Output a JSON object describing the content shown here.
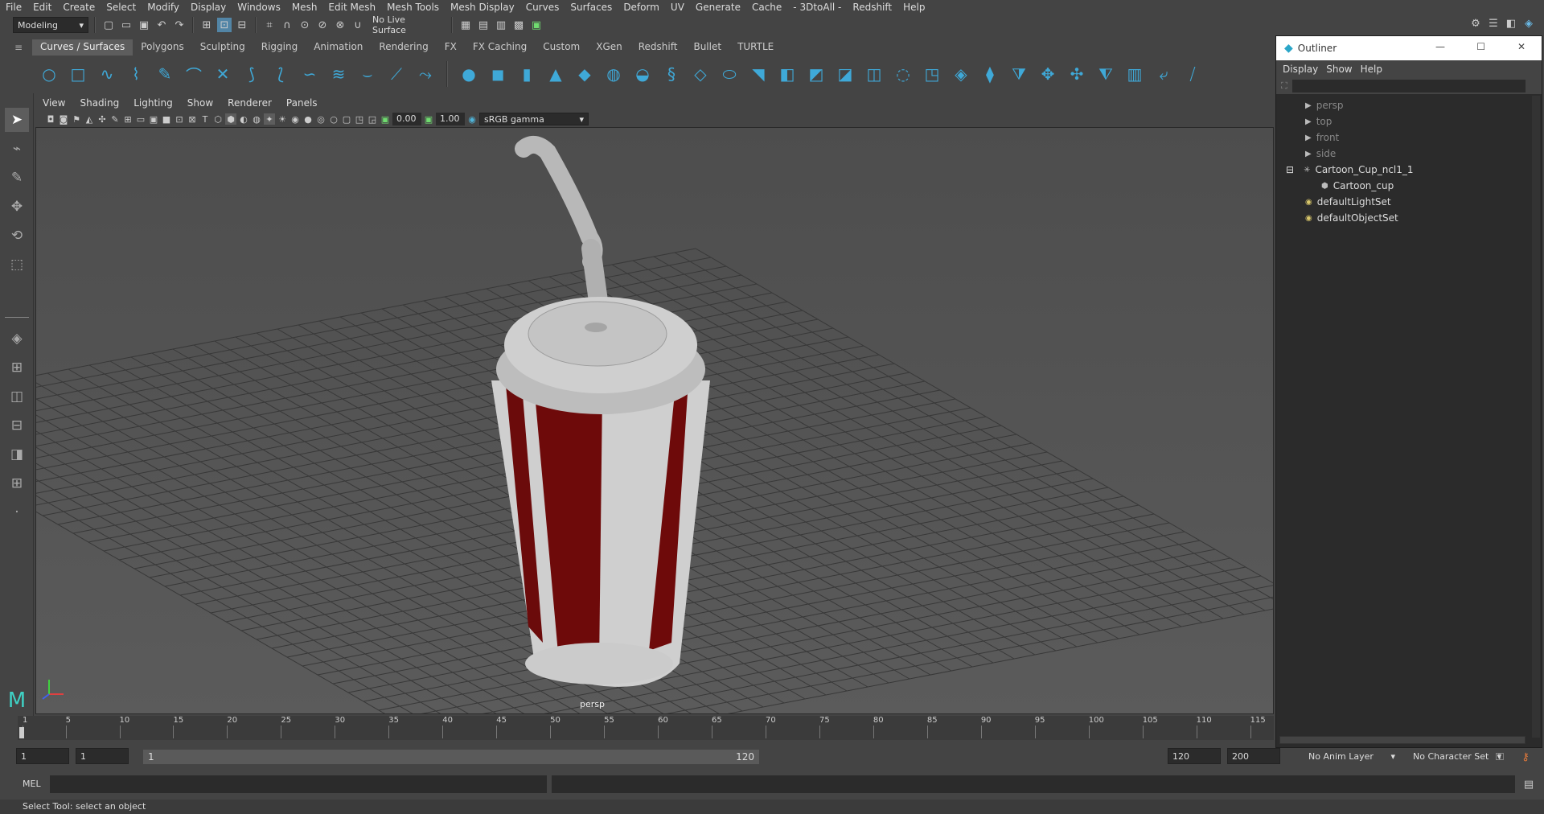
{
  "menubar": [
    "File",
    "Edit",
    "Create",
    "Select",
    "Modify",
    "Display",
    "Windows",
    "Mesh",
    "Edit Mesh",
    "Mesh Tools",
    "Mesh Display",
    "Curves",
    "Surfaces",
    "Deform",
    "UV",
    "Generate",
    "Cache",
    "- 3DtoAll -",
    "Redshift",
    "Help"
  ],
  "status": {
    "mode": "Modeling",
    "live_surface": "No Live Surface"
  },
  "shelf_tabs": [
    "Curves / Surfaces",
    "Polygons",
    "Sculpting",
    "Rigging",
    "Animation",
    "Rendering",
    "FX",
    "FX Caching",
    "Custom",
    "XGen",
    "Redshift",
    "Bullet",
    "TURTLE"
  ],
  "viewport": {
    "menu": [
      "View",
      "Shading",
      "Lighting",
      "Show",
      "Renderer",
      "Panels"
    ],
    "exposure": "0.00",
    "gamma": "1.00",
    "color_space": "sRGB gamma",
    "camera_label": "persp"
  },
  "timeline": {
    "ticks": [
      "1",
      "5",
      "10",
      "15",
      "20",
      "25",
      "30",
      "35",
      "40",
      "45",
      "50",
      "55",
      "60",
      "65",
      "70",
      "75",
      "80",
      "85",
      "90",
      "95",
      "100",
      "105",
      "110",
      "115"
    ],
    "current_frame": "1"
  },
  "range": {
    "start": "1",
    "playback_start": "1",
    "slider_start": "1",
    "slider_end": "120",
    "playback_end": "120",
    "end": "200",
    "anim_layer": "No Anim Layer",
    "character_set": "No Character Set"
  },
  "cmdline": {
    "label": "MEL"
  },
  "help_line": "Select Tool: select an object",
  "outliner": {
    "title": "Outliner",
    "menu": [
      "Display",
      "Show",
      "Help"
    ],
    "items": [
      {
        "label": "persp",
        "type": "camera",
        "dim": true,
        "indent": 1
      },
      {
        "label": "top",
        "type": "camera",
        "dim": true,
        "indent": 1
      },
      {
        "label": "front",
        "type": "camera",
        "dim": true,
        "indent": 1
      },
      {
        "label": "side",
        "type": "camera",
        "dim": true,
        "indent": 1
      },
      {
        "label": "Cartoon_Cup_ncl1_1",
        "type": "group",
        "dim": false,
        "indent": 1
      },
      {
        "label": "Cartoon_cup",
        "type": "mesh",
        "dim": false,
        "indent": 2
      },
      {
        "label": "defaultLightSet",
        "type": "set",
        "dim": false,
        "indent": 1
      },
      {
        "label": "defaultObjectSet",
        "type": "set",
        "dim": false,
        "indent": 1
      }
    ]
  }
}
